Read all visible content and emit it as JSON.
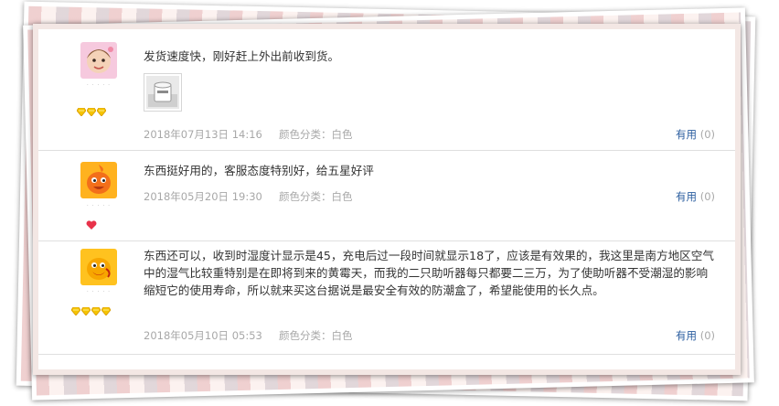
{
  "reviews": [
    {
      "text": "发货速度快，刚好赶上外出前收到货。",
      "date": "2018年07月13日 14:16",
      "spec": "颜色分类：白色",
      "useful_label": "有用",
      "useful_count": "(0)",
      "avatar_icon": "baby-photo-avatar",
      "level_icon": "diamond-icon",
      "level_count": 3
    },
    {
      "text": "东西挺好用的，客服态度特别好，给五星好评",
      "date": "2018年05月20日 19:30",
      "spec": "颜色分类：白色",
      "useful_label": "有用",
      "useful_count": "(0)",
      "avatar_icon": "orange-mascot-avatar",
      "level_icon": "heart-icon",
      "level_count": 1
    },
    {
      "text": "东西还可以，收到时湿度计显示是45，充电后过一段时间就显示18了，应该是有效果的，我这里是南方地区空气中的湿气比较重特别是在即将到来的黄霉天，而我的二只助听器每只都要二三万，为了使助听器不受潮湿的影响缩短它的使用寿命，所以就来买这台据说是最安全有效的防潮盒了，希望能使用的长久点。",
      "date": "2018年05月10日 05:53",
      "spec": "颜色分类：白色",
      "useful_label": "有用",
      "useful_count": "(0)",
      "avatar_icon": "yellow-mascot-avatar",
      "level_icon": "diamond-icon",
      "level_count": 4
    }
  ],
  "colors": {
    "text": "#333333",
    "meta": "#a8a8a8",
    "link": "#2a5d9f",
    "divider": "#dfdfdf"
  }
}
